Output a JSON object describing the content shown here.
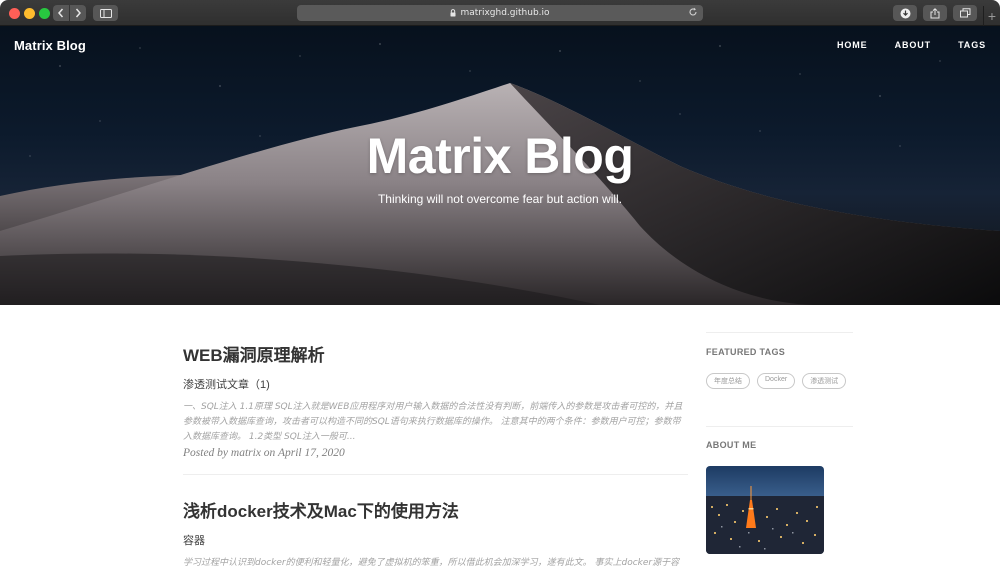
{
  "browser": {
    "url": "matrixghd.github.io",
    "new_tab_label": "+"
  },
  "site": {
    "brand": "Matrix Blog",
    "nav": [
      "HOME",
      "ABOUT",
      "TAGS"
    ],
    "hero_title": "Matrix Blog",
    "hero_subtitle": "Thinking will not overcome fear but action will."
  },
  "posts": [
    {
      "title": "WEB漏洞原理解析",
      "subtitle": "渗透测试文章（1)",
      "excerpt": "一、SQL注入 1.1原理 SQL注入就是WEB应用程序对用户输入数据的合法性没有判断，前端传入的参数是攻击者可控的，并且参数被带入数据库查询，攻击者可以构造不同的SQL语句来执行数据库的操作。 注意其中的两个条件：参数用户可控；参数带入数据库查询。 1.2类型 SQL注入一般可...",
      "meta": "Posted by matrix on April 17, 2020"
    },
    {
      "title": "浅析docker技术及Mac下的使用方法",
      "subtitle": "容器",
      "excerpt": "学习过程中认识到docker的便利和轻量化，避免了虚拟机的笨重，所以借此机会加深学习，遂有此文。 事实上docker源于容器，所以，我们从容器说起。 容器 . 包运用容器：容器就是将软件打包成标准化单元，以用于开发、交付和部署。"
    }
  ],
  "sidebar": {
    "featured_tags_heading": "FEATURED TAGS",
    "tags": [
      "年度总结",
      "Docker",
      "渗透测试"
    ],
    "about_heading": "ABOUT ME"
  },
  "colors": {
    "accent_text": "#333333",
    "muted": "#a3a3a3",
    "hero_sky": "#0c1a2c"
  }
}
